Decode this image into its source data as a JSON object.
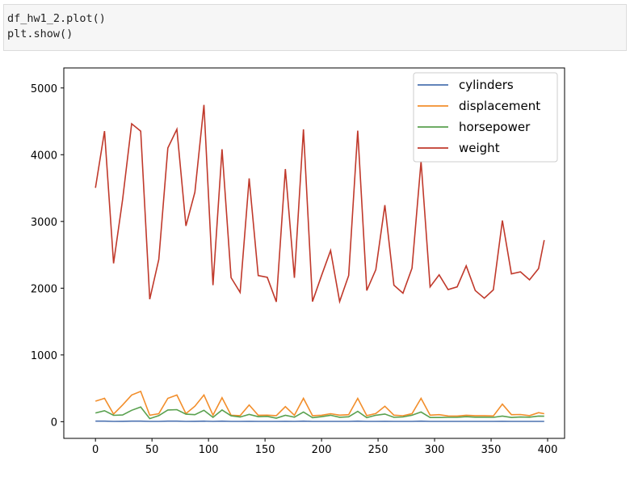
{
  "code_cell": {
    "lines": [
      "df_hw1_2.plot()",
      "plt.show()"
    ]
  },
  "chart_data": {
    "type": "line",
    "x": [
      0,
      8,
      16,
      24,
      32,
      40,
      48,
      56,
      64,
      72,
      80,
      88,
      96,
      104,
      112,
      120,
      128,
      136,
      144,
      152,
      160,
      168,
      176,
      184,
      192,
      200,
      208,
      216,
      224,
      232,
      240,
      248,
      256,
      264,
      272,
      280,
      288,
      296,
      304,
      312,
      320,
      328,
      336,
      344,
      352,
      360,
      368,
      376,
      384,
      392,
      397
    ],
    "series": [
      {
        "name": "cylinders",
        "color": "#4c72b0",
        "values": [
          8,
          8,
          4,
          6,
          8,
          8,
          4,
          4,
          8,
          8,
          4,
          6,
          8,
          4,
          8,
          4,
          4,
          6,
          4,
          4,
          4,
          6,
          4,
          8,
          4,
          4,
          4,
          4,
          4,
          8,
          4,
          4,
          6,
          4,
          4,
          4,
          8,
          4,
          4,
          4,
          4,
          4,
          4,
          4,
          4,
          6,
          4,
          4,
          4,
          4,
          4
        ]
      },
      {
        "name": "displacement",
        "color": "#f28e2b",
        "values": [
          307,
          350,
          113,
          250,
          400,
          454,
          97,
          120,
          350,
          400,
          121,
          232,
          400,
          98,
          360,
          97,
          90,
          250,
          96,
          98,
          91,
          225,
          97,
          350,
          91,
          97,
          120,
          98,
          105,
          350,
          91,
          122,
          231,
          98,
          89,
          119,
          350,
          98,
          105,
          86,
          85,
          97,
          91,
          91,
          86,
          262,
          105,
          108,
          91,
          135,
          119
        ]
      },
      {
        "name": "horsepower",
        "color": "#59a14f",
        "values": [
          130,
          165,
          95,
          100,
          170,
          220,
          46,
          90,
          175,
          180,
          112,
          105,
          170,
          65,
          175,
          88,
          70,
          110,
          75,
          80,
          53,
          95,
          67,
          145,
          60,
          75,
          97,
          66,
          74,
          155,
          60,
          96,
          115,
          65,
          71,
          97,
          145,
          63,
          63,
          65,
          65,
          75,
          68,
          67,
          65,
          85,
          63,
          70,
          67,
          84,
          82
        ]
      },
      {
        "name": "weight",
        "color": "#c0392b",
        "values": [
          3504,
          4354,
          2372,
          3329,
          4464,
          4354,
          1835,
          2430,
          4100,
          4382,
          2933,
          3439,
          4746,
          2045,
          4082,
          2158,
          1937,
          3645,
          2189,
          2164,
          1795,
          3785,
          2155,
          4380,
          1800,
          2189,
          2565,
          1800,
          2190,
          4360,
          1965,
          2278,
          3245,
          2045,
          1925,
          2300,
          3900,
          2020,
          2200,
          1980,
          2020,
          2335,
          1965,
          1850,
          1975,
          3015,
          2215,
          2245,
          2125,
          2295,
          2720
        ]
      }
    ],
    "xlim": [
      -28,
      415
    ],
    "ylim": [
      -250,
      5300
    ],
    "xticks": [
      0,
      50,
      100,
      150,
      200,
      250,
      300,
      350,
      400
    ],
    "yticks": [
      0,
      1000,
      2000,
      3000,
      4000,
      5000
    ],
    "legend_position": "top-right",
    "grid": false,
    "title": "",
    "xlabel": "",
    "ylabel": ""
  }
}
